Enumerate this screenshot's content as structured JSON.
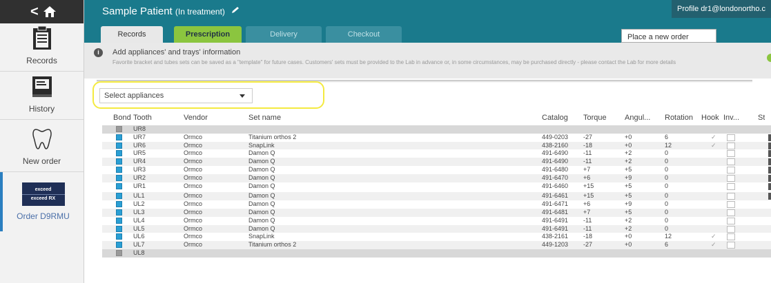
{
  "header": {
    "patient_name": "Sample Patient",
    "status": "(In treatment)",
    "profile": "Profile dr1@londonortho.c"
  },
  "sidebar": {
    "items": [
      {
        "label": "Records",
        "icon": "clipboard-icon"
      },
      {
        "label": "History",
        "icon": "book-icon"
      },
      {
        "label": "New order",
        "icon": "tooth-icon"
      }
    ],
    "logo_line1": "exceed",
    "logo_line2": "exceed RX",
    "order_label": "Order D9RMU"
  },
  "tabs": {
    "records": "Records",
    "prescription": "Prescription",
    "delivery": "Delivery",
    "checkout": "Checkout",
    "new_order": "Place a new order"
  },
  "info": {
    "title": "Add appliances' and trays' information",
    "description": "Favorite bracket and tubes sets can be saved as a \"template\" for future cases. Customers' sets must be provided to the Lab in advance or, in some circumstances, may be purchased directly - please contact the Lab for more details"
  },
  "select": {
    "placeholder": "Select appliances"
  },
  "table": {
    "columns": [
      "Bond",
      "Tooth",
      "Vendor",
      "Set name",
      "Catalog",
      "Torque",
      "Angul...",
      "Rotation",
      "Hook",
      "Inv...",
      "St"
    ],
    "rows": [
      {
        "tooth": "UR8",
        "vendor": "",
        "set": "",
        "catalog": "",
        "torque": "",
        "angul": "",
        "rotation": "",
        "hook": ""
      },
      {
        "tooth": "UR7",
        "vendor": "Ormco",
        "set": "Titanium orthos 2",
        "catalog": "449-0203",
        "torque": "-27",
        "angul": "+0",
        "rotation": "6",
        "hook": "✓"
      },
      {
        "tooth": "UR6",
        "vendor": "Ormco",
        "set": "SnapLink",
        "catalog": "438-2160",
        "torque": "-18",
        "angul": "+0",
        "rotation": "12",
        "hook": "✓"
      },
      {
        "tooth": "UR5",
        "vendor": "Ormco",
        "set": "Damon Q",
        "catalog": "491-6490",
        "torque": "-11",
        "angul": "+2",
        "rotation": "0",
        "hook": ""
      },
      {
        "tooth": "UR4",
        "vendor": "Ormco",
        "set": "Damon Q",
        "catalog": "491-6490",
        "torque": "-11",
        "angul": "+2",
        "rotation": "0",
        "hook": ""
      },
      {
        "tooth": "UR3",
        "vendor": "Ormco",
        "set": "Damon Q",
        "catalog": "491-6480",
        "torque": "+7",
        "angul": "+5",
        "rotation": "0",
        "hook": ""
      },
      {
        "tooth": "UR2",
        "vendor": "Ormco",
        "set": "Damon Q",
        "catalog": "491-6470",
        "torque": "+6",
        "angul": "+9",
        "rotation": "0",
        "hook": ""
      },
      {
        "tooth": "UR1",
        "vendor": "Ormco",
        "set": "Damon Q",
        "catalog": "491-6460",
        "torque": "+15",
        "angul": "+5",
        "rotation": "0",
        "hook": ""
      },
      {
        "tooth": "UL1",
        "vendor": "Ormco",
        "set": "Damon Q",
        "catalog": "491-6461",
        "torque": "+15",
        "angul": "+5",
        "rotation": "0",
        "hook": ""
      },
      {
        "tooth": "UL2",
        "vendor": "Ormco",
        "set": "Damon Q",
        "catalog": "491-6471",
        "torque": "+6",
        "angul": "+9",
        "rotation": "0",
        "hook": ""
      },
      {
        "tooth": "UL3",
        "vendor": "Ormco",
        "set": "Damon Q",
        "catalog": "491-6481",
        "torque": "+7",
        "angul": "+5",
        "rotation": "0",
        "hook": ""
      },
      {
        "tooth": "UL4",
        "vendor": "Ormco",
        "set": "Damon Q",
        "catalog": "491-6491",
        "torque": "-11",
        "angul": "+2",
        "rotation": "0",
        "hook": ""
      },
      {
        "tooth": "UL5",
        "vendor": "Ormco",
        "set": "Damon Q",
        "catalog": "491-6491",
        "torque": "-11",
        "angul": "+2",
        "rotation": "0",
        "hook": ""
      },
      {
        "tooth": "UL6",
        "vendor": "Ormco",
        "set": "SnapLink",
        "catalog": "438-2161",
        "torque": "-18",
        "angul": "+0",
        "rotation": "12",
        "hook": "✓"
      },
      {
        "tooth": "UL7",
        "vendor": "Ormco",
        "set": "Titanium orthos 2",
        "catalog": "449-1203",
        "torque": "-27",
        "angul": "+0",
        "rotation": "6",
        "hook": "✓"
      },
      {
        "tooth": "UL8",
        "vendor": "",
        "set": "",
        "catalog": "",
        "torque": "",
        "angul": "",
        "rotation": "",
        "hook": ""
      }
    ]
  },
  "colors": {
    "header_teal": "#1a7a8c",
    "tab_green": "#8bc53f",
    "highlight_yellow": "#f4ea3f",
    "bond_blue": "#2a9fd4"
  }
}
